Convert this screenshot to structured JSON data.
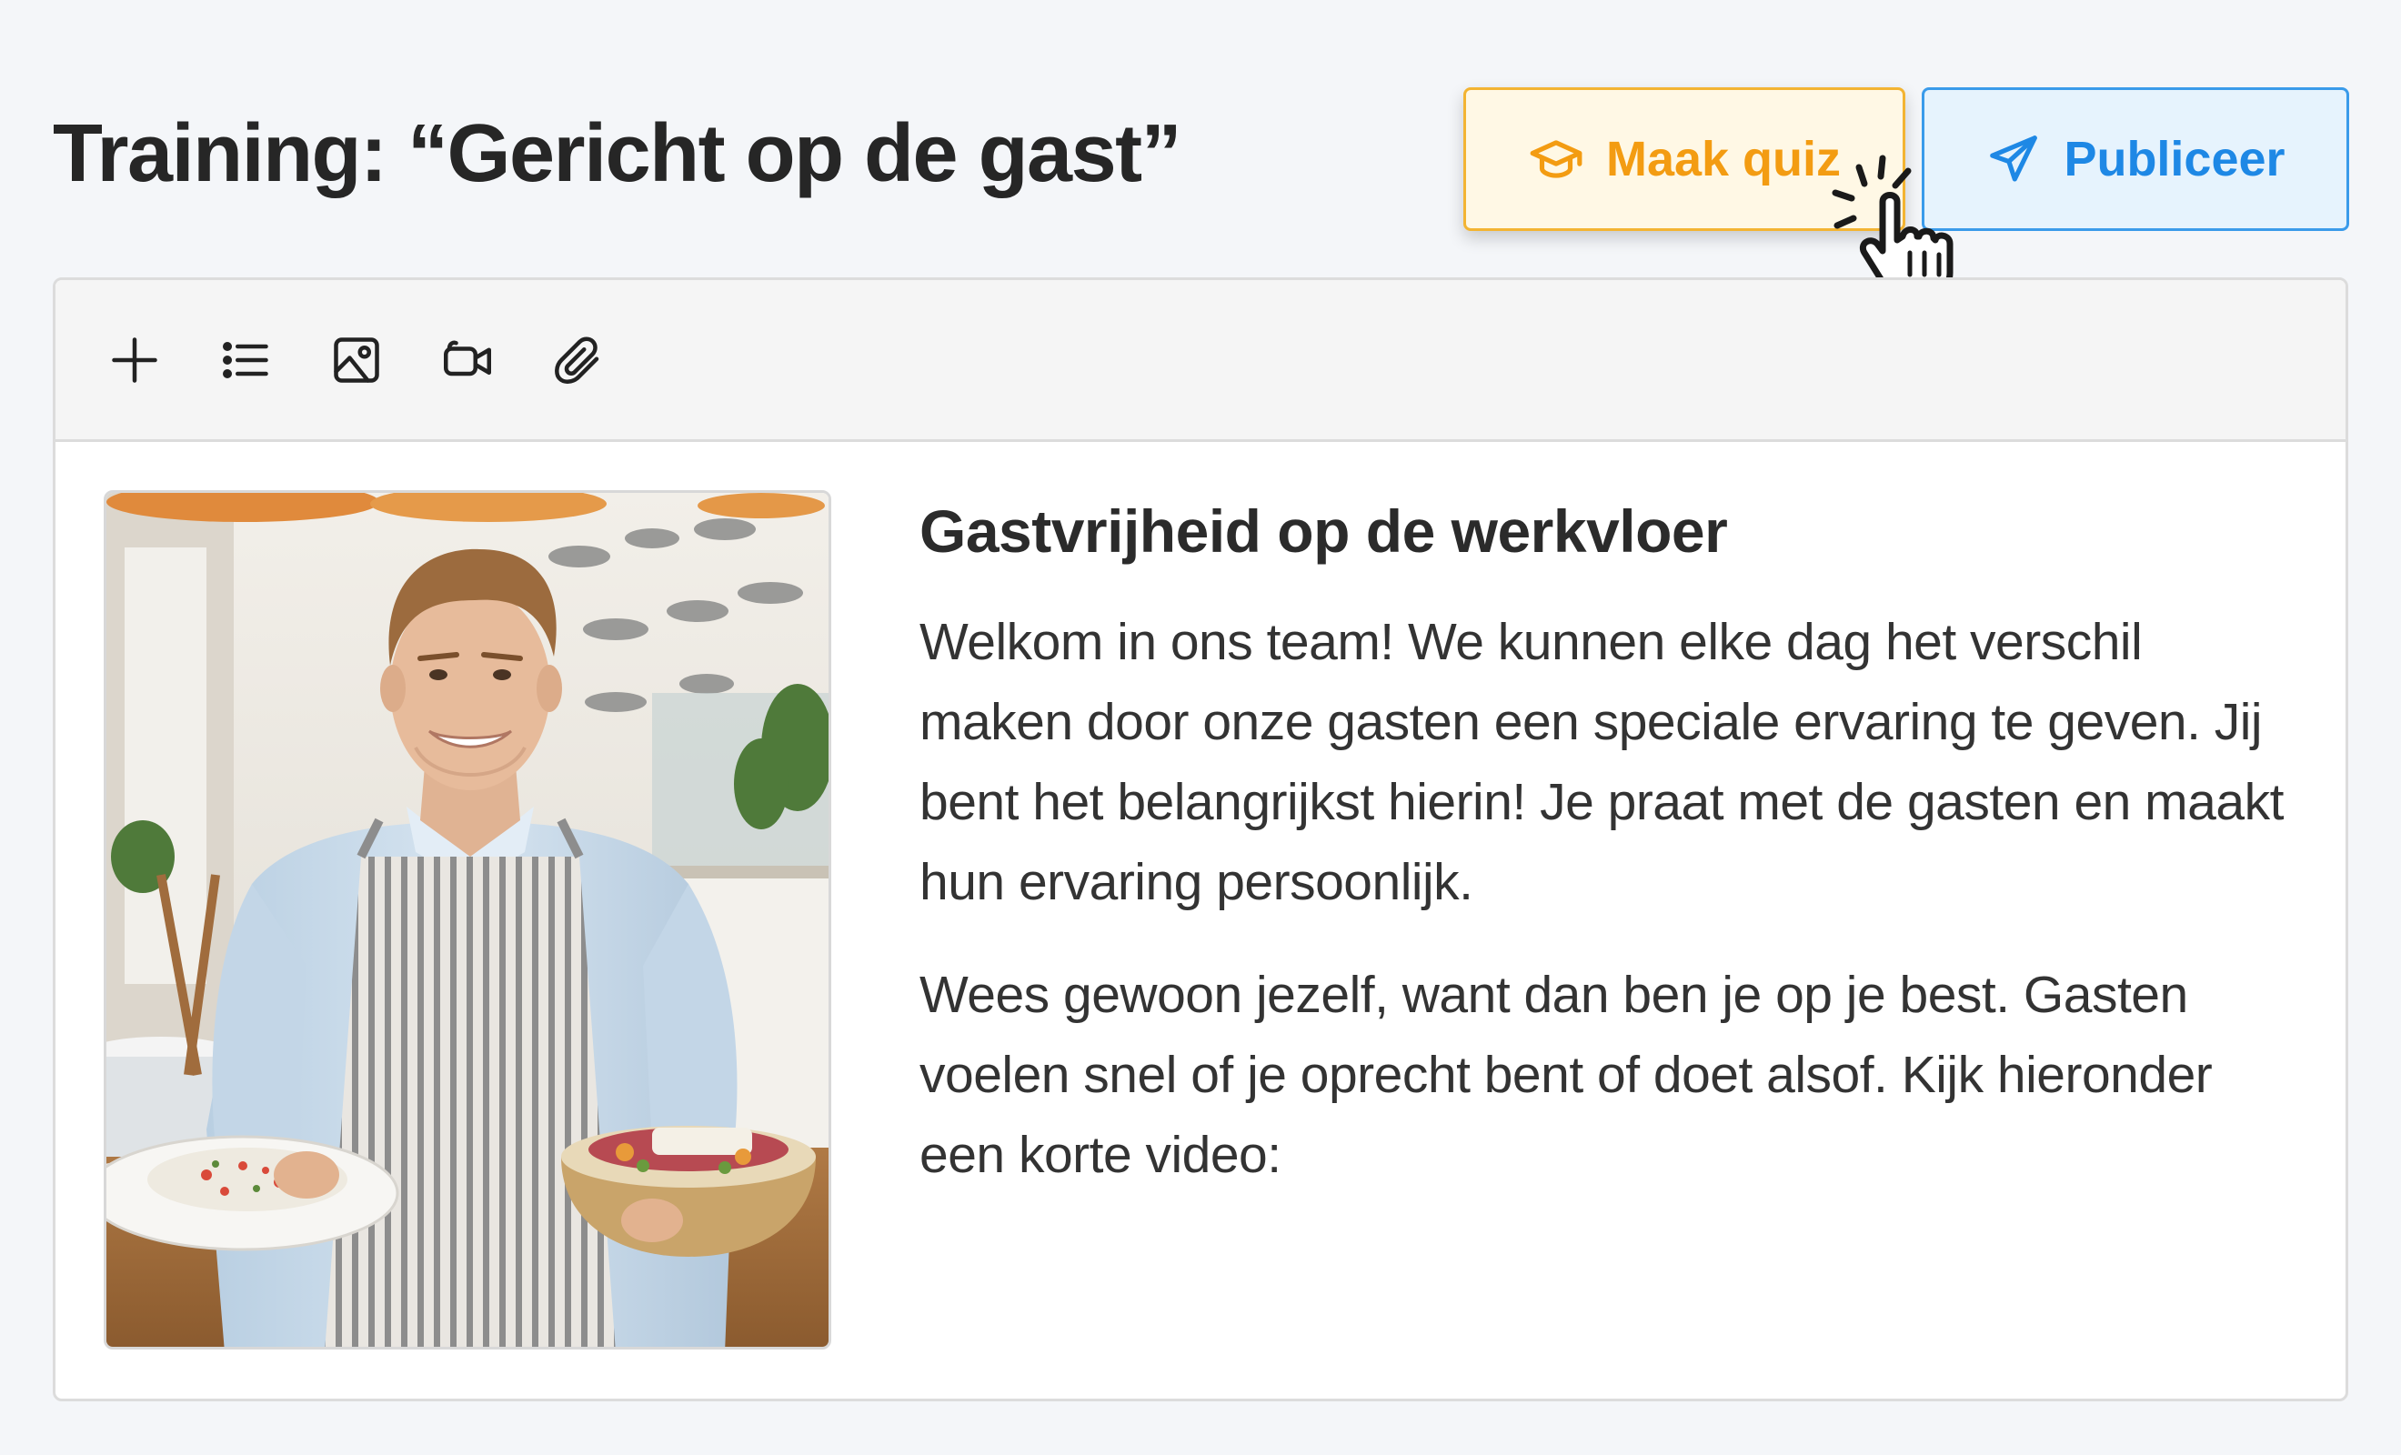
{
  "page": {
    "title": "Training: “Gericht op de gast”"
  },
  "actions": {
    "quiz_label": "Maak quiz",
    "publish_label": "Publiceer"
  },
  "toolbar": {
    "tools": [
      "plus-icon",
      "list-icon",
      "image-icon",
      "video-icon",
      "paperclip-icon"
    ]
  },
  "article": {
    "heading": "Gastvrijheid op de werkvloer",
    "paragraphs": [
      "Welkom in ons team! We kunnen elke dag het verschil maken door onze gasten een speciale ervaring te geven. Jij bent het belangrijkst hierin! Je praat met de gasten en maakt hun ervaring persoonlijk.",
      "Wees gewoon jezelf, want dan ben je op je best. Gasten voelen snel of je oprecht bent of doet alsof. Kijk hieronder een korte video:"
    ]
  },
  "colors": {
    "quiz_accent": "#f39c12",
    "publish_accent": "#1e88e5",
    "background": "#f4f6f9"
  }
}
